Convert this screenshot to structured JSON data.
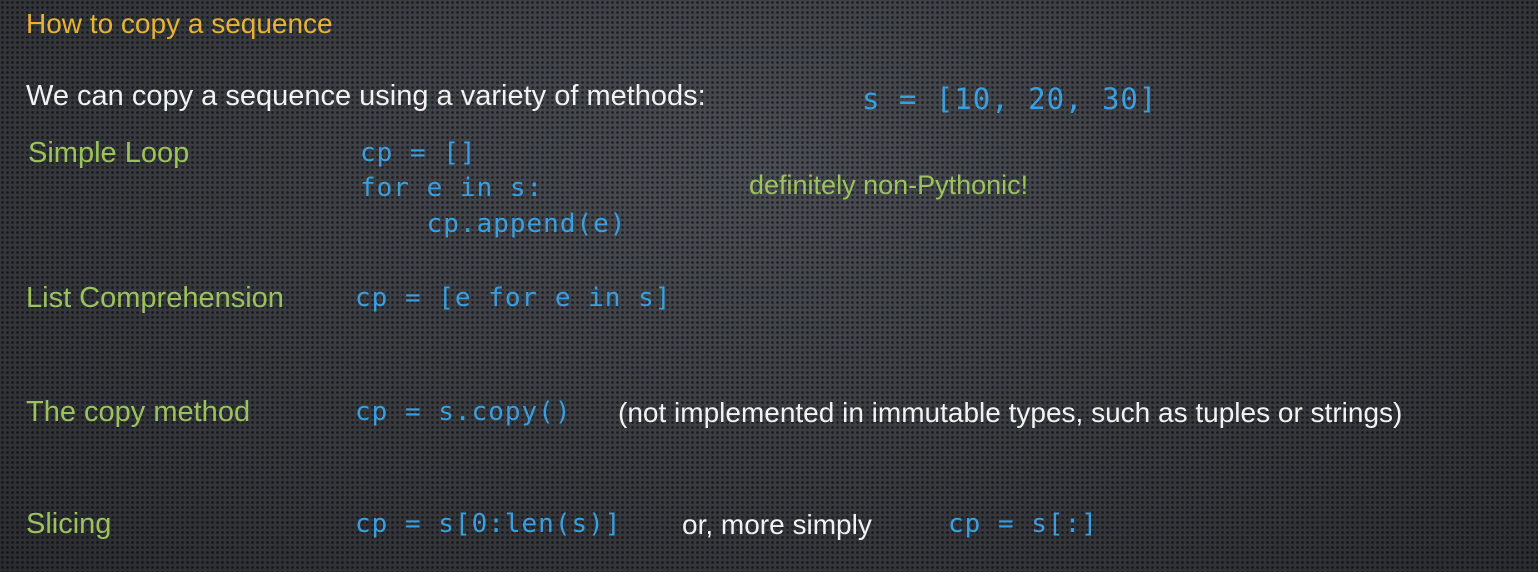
{
  "title": "How to copy a sequence",
  "intro": {
    "text": "We can copy a sequence using a variety of methods:",
    "example_code": "s = [10, 20, 30]"
  },
  "methods": {
    "simple_loop": {
      "label": "Simple Loop",
      "code_lines": [
        "cp = []",
        "for e in s:",
        "    cp.append(e)"
      ],
      "note": "definitely non-Pythonic!"
    },
    "list_comprehension": {
      "label": "List Comprehension",
      "code": "cp = [e for e in s]"
    },
    "copy_method": {
      "label": "The copy method",
      "code": "cp = s.copy()",
      "note": "(not implemented in immutable types, such as tuples or strings)"
    },
    "slicing": {
      "label": "Slicing",
      "code": "cp = s[0:len(s)]",
      "connector": "or, more simply",
      "code_alt": "cp = s[:]"
    }
  },
  "colors": {
    "title": "#e8b233",
    "label": "#9cc35b",
    "code": "#3a9fe0",
    "text": "#f2f2f2",
    "background": "#3a3d42"
  }
}
